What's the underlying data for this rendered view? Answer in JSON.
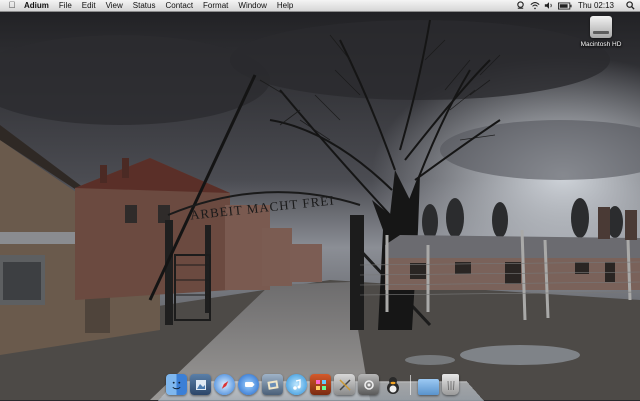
{
  "menubar": {
    "apple_icon": "apple-icon",
    "app_name": "Adium",
    "items": [
      "File",
      "Edit",
      "View",
      "Status",
      "Contact",
      "Format",
      "Window",
      "Help"
    ],
    "status_icons": [
      "adium-duck-icon",
      "wifi-icon",
      "volume-icon",
      "battery-icon"
    ],
    "clock": "Thu 02:13",
    "spotlight_icon": "spotlight-search-icon"
  },
  "desktop": {
    "drive_label": "Macintosh HD",
    "wallpaper_sign_text": "ARBEIT MACHT FREI"
  },
  "dock": {
    "items": [
      {
        "name": "finder-icon"
      },
      {
        "name": "preview-icon"
      },
      {
        "name": "safari-icon"
      },
      {
        "name": "ichat-icon"
      },
      {
        "name": "iphoto-icon"
      },
      {
        "name": "itunes-icon"
      },
      {
        "name": "photo-booth-icon"
      },
      {
        "name": "utilities-icon"
      },
      {
        "name": "system-preferences-icon"
      },
      {
        "name": "adium-icon"
      }
    ],
    "right_items": [
      {
        "name": "folder-icon"
      },
      {
        "name": "trash-icon"
      }
    ]
  }
}
